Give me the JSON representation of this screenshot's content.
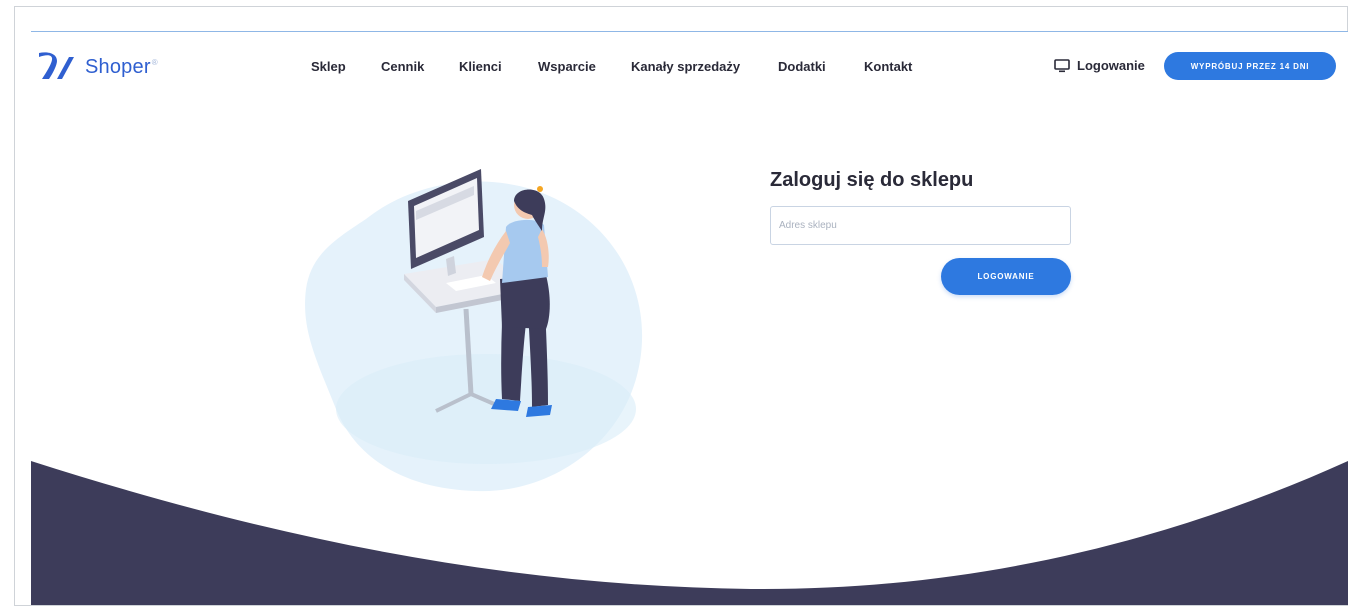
{
  "header": {
    "logo_text": "Shoper",
    "nav": [
      "Sklep",
      "Cennik",
      "Klienci",
      "Wsparcie",
      "Kanały sprzedaży",
      "Dodatki",
      "Kontakt"
    ],
    "login_label": "Logowanie",
    "trial_button": "WYPRÓBUJ PRZEZ 14 DNI"
  },
  "login_form": {
    "title": "Zaloguj się do sklepu",
    "input_placeholder": "Adres sklepu",
    "submit_label": "LOGOWANIE"
  },
  "colors": {
    "accent": "#2e79e0",
    "dark_wave": "#3d3c5a",
    "text": "#2a2a38"
  },
  "icons": {
    "logo": "shoper-logo-icon",
    "login": "monitor-icon"
  }
}
